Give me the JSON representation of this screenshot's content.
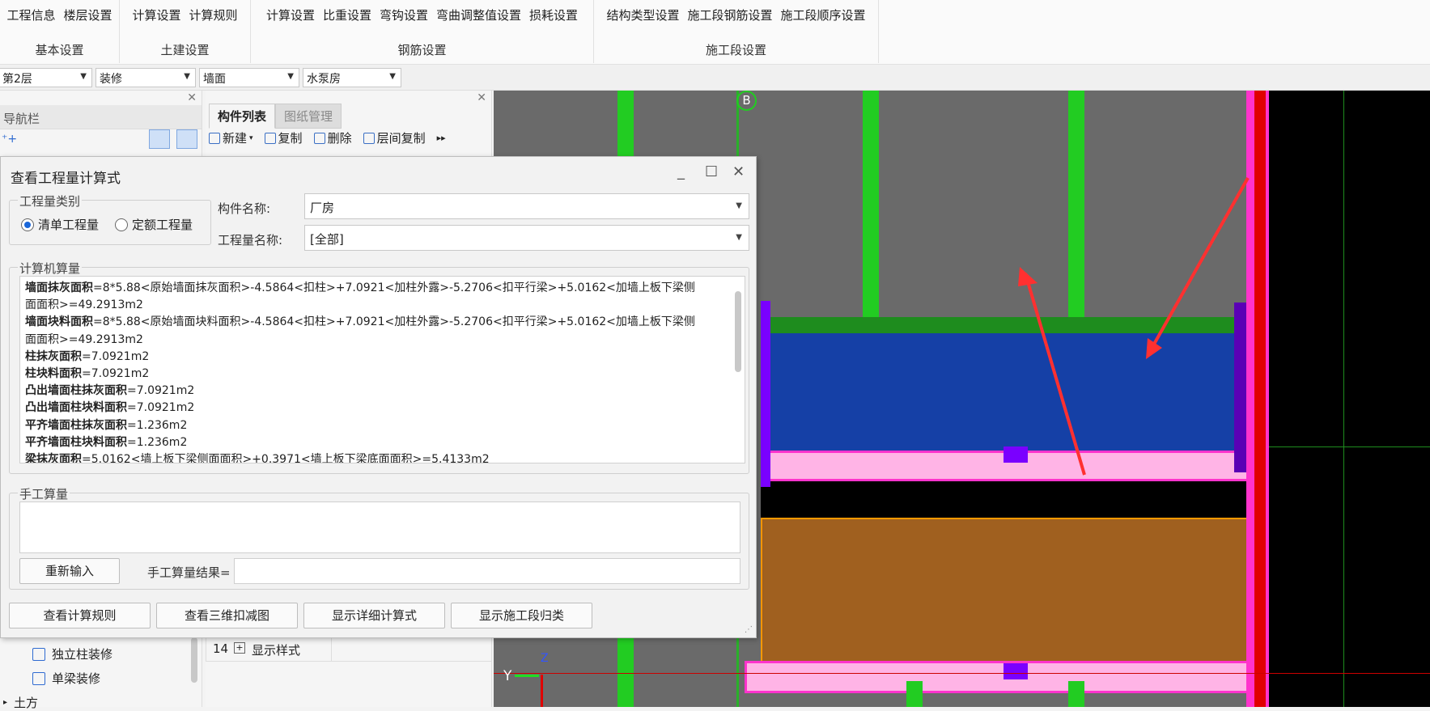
{
  "ribbon": {
    "groups": [
      {
        "label": "基本设置",
        "items": [
          "工程信息",
          "楼层设置"
        ]
      },
      {
        "label": "土建设置",
        "items": [
          "计算设置",
          "计算规则"
        ]
      },
      {
        "label": "钢筋设置",
        "items": [
          "计算设置",
          "比重设置",
          "弯钩设置",
          "弯曲调整值设置",
          "损耗设置"
        ]
      },
      {
        "label": "施工段设置",
        "items": [
          "结构类型设置",
          "施工段钢筋设置",
          "施工段顺序设置"
        ]
      }
    ]
  },
  "selectors": {
    "floor": "第2层",
    "category": "装修",
    "type": "墙面",
    "component": "水泵房"
  },
  "nav_panel": {
    "title": "导航栏",
    "items": [
      "独立柱装修",
      "单梁装修",
      "土方"
    ]
  },
  "component_panel": {
    "tabs": [
      "构件列表",
      "图纸管理"
    ],
    "toolbar": [
      "新建",
      "复制",
      "删除",
      "层间复制"
    ],
    "row": {
      "index": "14",
      "label": "显示样式"
    }
  },
  "dialog": {
    "title": "查看工程量计算式",
    "quantity_type": {
      "legend": "工程量类别",
      "options": [
        "清单工程量",
        "定额工程量"
      ],
      "selected": "清单工程量"
    },
    "component_name": {
      "label": "构件名称:",
      "value": "厂房"
    },
    "quantity_name": {
      "label": "工程量名称:",
      "value": "[全部]"
    },
    "computer": {
      "legend": "计算机算量",
      "lines": [
        {
          "bold": "墙面抹灰面积",
          "text": "=8*5.88<原始墙面抹灰面积>-4.5864<扣柱>+7.0921<加柱外露>-5.2706<扣平行梁>+5.0162<加墙上板下梁侧"
        },
        {
          "bold": "",
          "text": "面面积>=49.2913m2"
        },
        {
          "bold": "墙面块料面积",
          "text": "=8*5.88<原始墙面块料面积>-4.5864<扣柱>+7.0921<加柱外露>-5.2706<扣平行梁>+5.0162<加墙上板下梁侧"
        },
        {
          "bold": "",
          "text": "面面积>=49.2913m2"
        },
        {
          "bold": "柱抹灰面积",
          "text": "=7.0921m2"
        },
        {
          "bold": "柱块料面积",
          "text": "=7.0921m2"
        },
        {
          "bold": "凸出墙面柱抹灰面积",
          "text": "=7.0921m2"
        },
        {
          "bold": "凸出墙面柱块料面积",
          "text": "=7.0921m2"
        },
        {
          "bold": "平齐墙面柱抹灰面积",
          "text": "=1.236m2"
        },
        {
          "bold": "平齐墙面柱块料面积",
          "text": "=1.236m2"
        },
        {
          "bold": "梁抹灰面积",
          "text": "=5.0162<墙上板下梁侧面面积>+0.3971<墙上板下梁底面面积>=5.4133m2"
        }
      ]
    },
    "manual": {
      "legend": "手工算量",
      "reenter": "重新输入",
      "result_label": "手工算量结果="
    },
    "buttons": [
      "查看计算规则",
      "查看三维扣减图",
      "显示详细计算式",
      "显示施工段归类"
    ]
  },
  "canvas": {
    "axis_label": "B",
    "y_label": "Y",
    "z_label": "Z"
  }
}
